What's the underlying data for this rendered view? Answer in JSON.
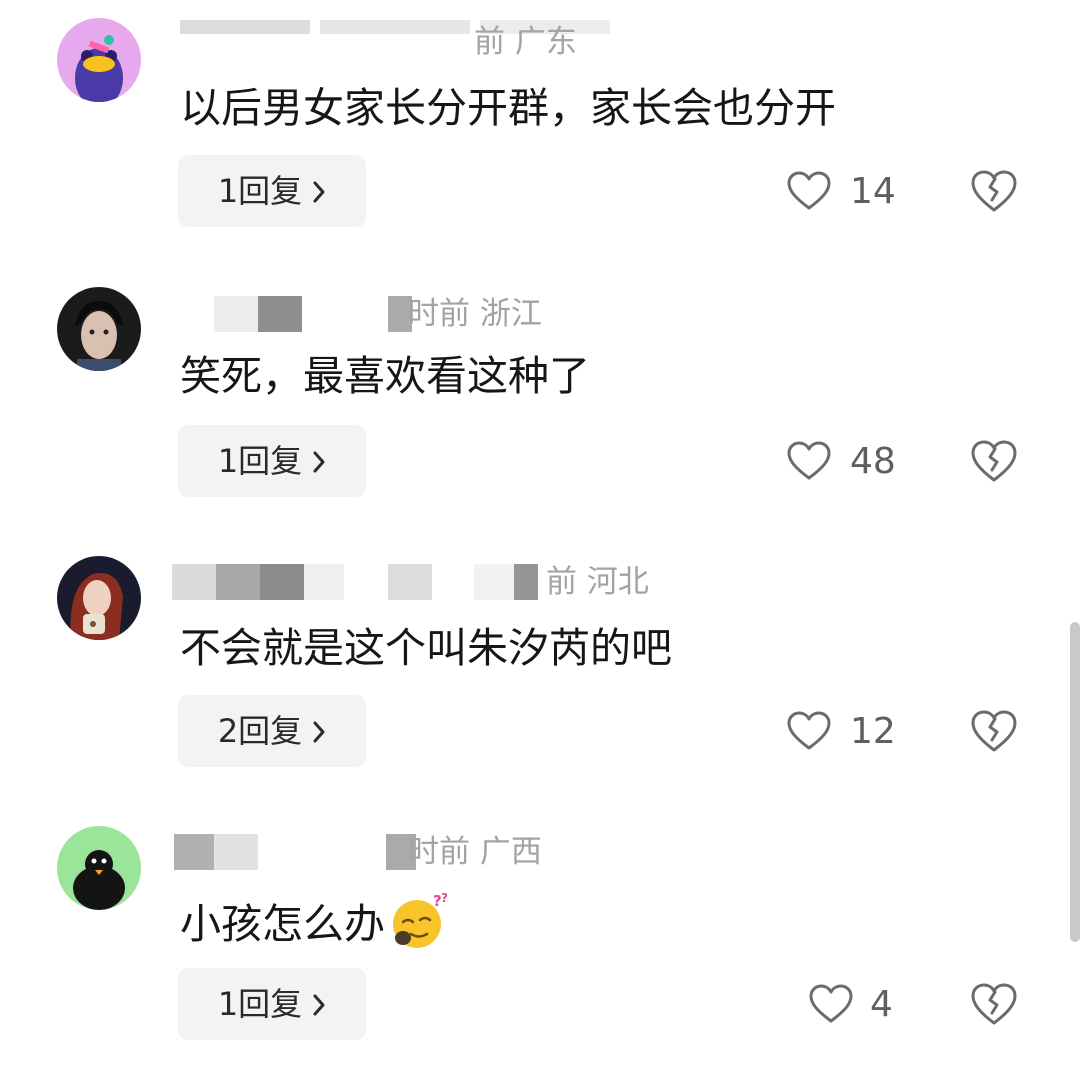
{
  "comments": [
    {
      "meta_suffix": "前 广东",
      "text": "以后男女家长分开群，家长会也分开",
      "reply_label": "1回复",
      "likes": "14"
    },
    {
      "meta_suffix": "时前 浙江",
      "text": "笑死，最喜欢看这种了",
      "reply_label": "1回复",
      "likes": "48"
    },
    {
      "meta_suffix": "前 河北",
      "text": "不会就是这个叫朱汐芮的吧",
      "reply_label": "2回复",
      "likes": "12"
    },
    {
      "meta_suffix": "时前 广西",
      "text": "小孩怎么办",
      "reply_label": "1回复",
      "likes": "4"
    }
  ],
  "icons": {
    "reply_chevron": "chevron-right-icon",
    "like": "heart-icon",
    "dislike": "broken-heart-icon",
    "emoji": "sleepy-face-emoji"
  },
  "colors": {
    "text": "#161616",
    "meta": "#a3a3a3",
    "count": "#5f5f5f",
    "reply_bg": "#f3f3f3",
    "icon_stroke": "#6b6b6b"
  }
}
